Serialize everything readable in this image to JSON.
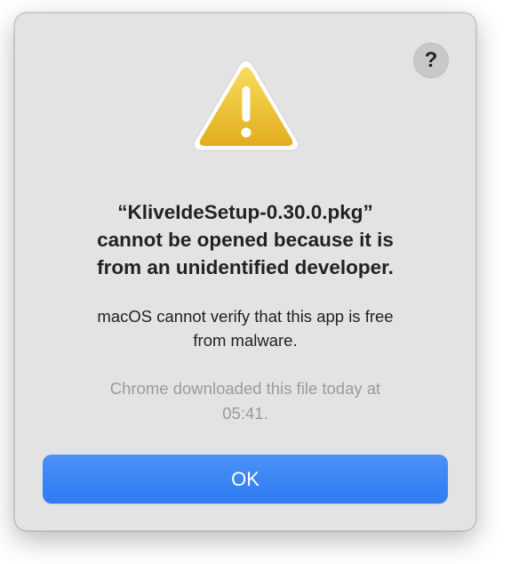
{
  "dialog": {
    "help_label": "?",
    "icon": "warning-triangle-icon",
    "title_line1": "“KliveIdeSetup-0.30.0.pkg”",
    "title_line2": "cannot be opened because it is",
    "title_line3": "from an unidentified developer.",
    "message_line1": "macOS cannot verify that this app is free",
    "message_line2": "from malware.",
    "info_line1": "Chrome downloaded this file today at",
    "info_line2": "05:41.",
    "ok_label": "OK"
  },
  "colors": {
    "dialog_background": "#e3e3e3",
    "primary_button": "#3a84f5",
    "warning_yellow": "#f2c233",
    "secondary_text": "#9b9b9b"
  }
}
